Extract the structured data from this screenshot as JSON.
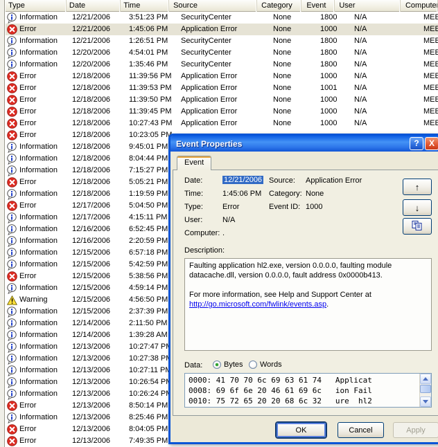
{
  "list": {
    "columns": [
      "Type",
      "Date",
      "Time",
      "Source",
      "Category",
      "Event",
      "User",
      "Computer"
    ],
    "rows": [
      {
        "type": "Information",
        "date": "12/21/2006",
        "time": "3:51:23 PM",
        "source": "SecurityCenter",
        "category": "None",
        "event": "1800",
        "user": "N/A",
        "computer": "MEEK",
        "selected": false
      },
      {
        "type": "Error",
        "date": "12/21/2006",
        "time": "1:45:06 PM",
        "source": "Application Error",
        "category": "None",
        "event": "1000",
        "user": "N/A",
        "computer": "MEEK",
        "selected": true
      },
      {
        "type": "Information",
        "date": "12/21/2006",
        "time": "1:26:51 PM",
        "source": "SecurityCenter",
        "category": "None",
        "event": "1800",
        "user": "N/A",
        "computer": "MEEK",
        "selected": false
      },
      {
        "type": "Information",
        "date": "12/20/2006",
        "time": "4:54:01 PM",
        "source": "SecurityCenter",
        "category": "None",
        "event": "1800",
        "user": "N/A",
        "computer": "MEEK",
        "selected": false
      },
      {
        "type": "Information",
        "date": "12/20/2006",
        "time": "1:35:46 PM",
        "source": "SecurityCenter",
        "category": "None",
        "event": "1800",
        "user": "N/A",
        "computer": "MEEK",
        "selected": false
      },
      {
        "type": "Error",
        "date": "12/18/2006",
        "time": "11:39:56 PM",
        "source": "Application Error",
        "category": "None",
        "event": "1000",
        "user": "N/A",
        "computer": "MEEK",
        "selected": false
      },
      {
        "type": "Error",
        "date": "12/18/2006",
        "time": "11:39:53 PM",
        "source": "Application Error",
        "category": "None",
        "event": "1001",
        "user": "N/A",
        "computer": "MEEK",
        "selected": false
      },
      {
        "type": "Error",
        "date": "12/18/2006",
        "time": "11:39:50 PM",
        "source": "Application Error",
        "category": "None",
        "event": "1000",
        "user": "N/A",
        "computer": "MEEK",
        "selected": false
      },
      {
        "type": "Error",
        "date": "12/18/2006",
        "time": "11:39:45 PM",
        "source": "Application Error",
        "category": "None",
        "event": "1000",
        "user": "N/A",
        "computer": "MEEK",
        "selected": false
      },
      {
        "type": "Error",
        "date": "12/18/2006",
        "time": "10:27:43 PM",
        "source": "Application Error",
        "category": "None",
        "event": "1000",
        "user": "N/A",
        "computer": "MEEK",
        "selected": false
      },
      {
        "type": "Error",
        "date": "12/18/2006",
        "time": "10:23:05 PM",
        "source": "",
        "category": "",
        "event": "",
        "user": "",
        "computer": "",
        "selected": false
      },
      {
        "type": "Information",
        "date": "12/18/2006",
        "time": "9:45:01 PM",
        "source": "",
        "category": "",
        "event": "",
        "user": "",
        "computer": "",
        "selected": false
      },
      {
        "type": "Information",
        "date": "12/18/2006",
        "time": "8:04:44 PM",
        "source": "",
        "category": "",
        "event": "",
        "user": "",
        "computer": "",
        "selected": false
      },
      {
        "type": "Information",
        "date": "12/18/2006",
        "time": "7:15:27 PM",
        "source": "",
        "category": "",
        "event": "",
        "user": "",
        "computer": "",
        "selected": false
      },
      {
        "type": "Error",
        "date": "12/18/2006",
        "time": "5:05:21 PM",
        "source": "",
        "category": "",
        "event": "",
        "user": "",
        "computer": "",
        "selected": false
      },
      {
        "type": "Information",
        "date": "12/18/2006",
        "time": "1:19:59 PM",
        "source": "",
        "category": "",
        "event": "",
        "user": "",
        "computer": "",
        "selected": false
      },
      {
        "type": "Error",
        "date": "12/17/2006",
        "time": "5:04:50 PM",
        "source": "",
        "category": "",
        "event": "",
        "user": "",
        "computer": "",
        "selected": false
      },
      {
        "type": "Information",
        "date": "12/17/2006",
        "time": "4:15:11 PM",
        "source": "",
        "category": "",
        "event": "",
        "user": "",
        "computer": "",
        "selected": false
      },
      {
        "type": "Information",
        "date": "12/16/2006",
        "time": "6:52:45 PM",
        "source": "",
        "category": "",
        "event": "",
        "user": "",
        "computer": "",
        "selected": false
      },
      {
        "type": "Information",
        "date": "12/16/2006",
        "time": "2:20:59 PM",
        "source": "",
        "category": "",
        "event": "",
        "user": "",
        "computer": "",
        "selected": false
      },
      {
        "type": "Information",
        "date": "12/15/2006",
        "time": "6:57:18 PM",
        "source": "",
        "category": "",
        "event": "",
        "user": "",
        "computer": "",
        "selected": false
      },
      {
        "type": "Information",
        "date": "12/15/2006",
        "time": "5:42:59 PM",
        "source": "",
        "category": "",
        "event": "",
        "user": "",
        "computer": "",
        "selected": false
      },
      {
        "type": "Error",
        "date": "12/15/2006",
        "time": "5:38:56 PM",
        "source": "",
        "category": "",
        "event": "",
        "user": "",
        "computer": "",
        "selected": false
      },
      {
        "type": "Information",
        "date": "12/15/2006",
        "time": "4:59:14 PM",
        "source": "",
        "category": "",
        "event": "",
        "user": "",
        "computer": "",
        "selected": false
      },
      {
        "type": "Warning",
        "date": "12/15/2006",
        "time": "4:56:50 PM",
        "source": "",
        "category": "",
        "event": "",
        "user": "",
        "computer": "",
        "selected": false
      },
      {
        "type": "Information",
        "date": "12/15/2006",
        "time": "2:37:39 PM",
        "source": "",
        "category": "",
        "event": "",
        "user": "",
        "computer": "",
        "selected": false
      },
      {
        "type": "Information",
        "date": "12/14/2006",
        "time": "2:11:50 PM",
        "source": "",
        "category": "",
        "event": "",
        "user": "",
        "computer": "",
        "selected": false
      },
      {
        "type": "Information",
        "date": "12/14/2006",
        "time": "1:39:28 AM",
        "source": "",
        "category": "",
        "event": "",
        "user": "",
        "computer": "",
        "selected": false
      },
      {
        "type": "Information",
        "date": "12/13/2006",
        "time": "10:27:47 PM",
        "source": "",
        "category": "",
        "event": "",
        "user": "",
        "computer": "",
        "selected": false
      },
      {
        "type": "Information",
        "date": "12/13/2006",
        "time": "10:27:38 PM",
        "source": "",
        "category": "",
        "event": "",
        "user": "",
        "computer": "",
        "selected": false
      },
      {
        "type": "Information",
        "date": "12/13/2006",
        "time": "10:27:11 PM",
        "source": "",
        "category": "",
        "event": "",
        "user": "",
        "computer": "",
        "selected": false
      },
      {
        "type": "Information",
        "date": "12/13/2006",
        "time": "10:26:54 PM",
        "source": "",
        "category": "",
        "event": "",
        "user": "",
        "computer": "",
        "selected": false
      },
      {
        "type": "Information",
        "date": "12/13/2006",
        "time": "10:26:24 PM",
        "source": "",
        "category": "",
        "event": "",
        "user": "",
        "computer": "",
        "selected": false
      },
      {
        "type": "Error",
        "date": "12/13/2006",
        "time": "8:50:14 PM",
        "source": "",
        "category": "",
        "event": "",
        "user": "",
        "computer": "",
        "selected": false
      },
      {
        "type": "Information",
        "date": "12/13/2006",
        "time": "8:25:46 PM",
        "source": "",
        "category": "",
        "event": "",
        "user": "",
        "computer": "",
        "selected": false
      },
      {
        "type": "Error",
        "date": "12/13/2006",
        "time": "8:04:05 PM",
        "source": "",
        "category": "",
        "event": "",
        "user": "",
        "computer": "",
        "selected": false
      },
      {
        "type": "Error",
        "date": "12/13/2006",
        "time": "7:49:35 PM",
        "source": "",
        "category": "",
        "event": "",
        "user": "",
        "computer": "",
        "selected": false
      }
    ]
  },
  "dialog": {
    "title": "Event Properties",
    "help_glyph": "?",
    "close_glyph": "X",
    "tab_label": "Event",
    "fields": {
      "date_label": "Date:",
      "date_value": "12/21/2006",
      "time_label": "Time:",
      "time_value": "1:45:06 PM",
      "type_label": "Type:",
      "type_value": "Error",
      "user_label": "User:",
      "user_value": "N/A",
      "computer_label": "Computer:",
      "computer_value": ".",
      "source_label": "Source:",
      "source_value": "Application Error",
      "category_label": "Category:",
      "category_value": "None",
      "event_id_label": "Event ID:",
      "event_id_value": "1000"
    },
    "nav": {
      "up_glyph": "↑",
      "down_glyph": "↓"
    },
    "description": {
      "label": "Description:",
      "para1": "Faulting application hl2.exe, version 0.0.0.0, faulting module datacache.dll, version 0.0.0.0, fault address 0x0000b413.",
      "para2": "For more information, see Help and Support Center at",
      "link": "http://go.microsoft.com/fwlink/events.asp",
      "link_suffix": "."
    },
    "data_section": {
      "label": "Data:",
      "bytes_label": "Bytes",
      "words_label": "Words",
      "selected": "Bytes",
      "hex_lines": [
        "0000: 41 70 70 6c 69 63 61 74   Applicat",
        "0008: 69 6f 6e 20 46 61 69 6c   ion Fail",
        "0010: 75 72 65 20 20 68 6c 32   ure  hl2"
      ]
    },
    "buttons": {
      "ok": "OK",
      "cancel": "Cancel",
      "apply": "Apply"
    }
  }
}
